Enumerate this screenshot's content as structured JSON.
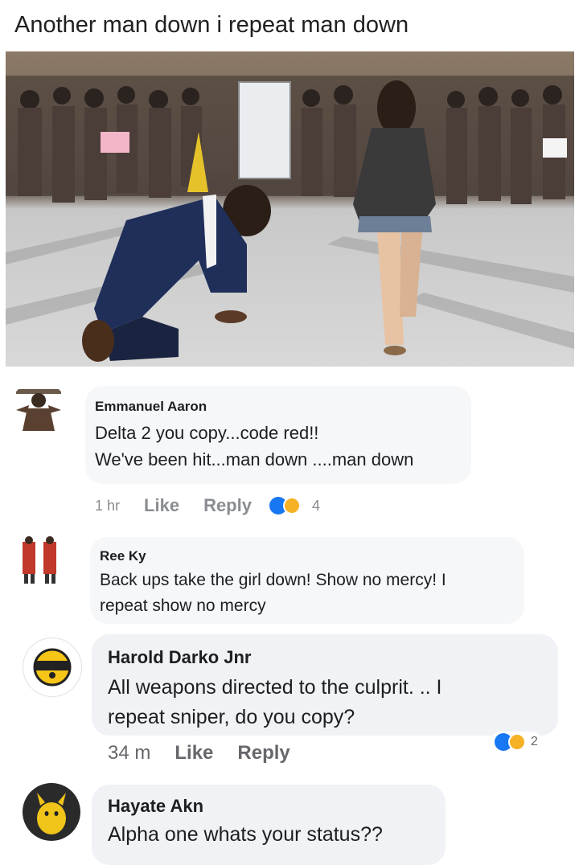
{
  "post": {
    "title": "Another man down i repeat man down"
  },
  "photo": {
    "description_icon": "image",
    "accent_suit": "#1f2f5a",
    "floor_color": "#c9c9c9"
  },
  "comments": [
    {
      "name": "Emmanuel Aaron",
      "text": "Delta 2 you copy...code red!!\nWe've been hit...man down ....man down",
      "time": "1 hr",
      "like": "Like",
      "reply": "Reply",
      "reactions": "4",
      "reaction_icons": [
        "like-icon",
        "haha-icon"
      ]
    },
    {
      "name": "Ree Ky",
      "text": "Back ups take the girl down! Show no mercy! I\nrepeat show no mercy"
    },
    {
      "name": "Harold Darko Jnr",
      "text": "All weapons directed to the culprit. .. I\nrepeat sniper, do you copy?",
      "time": "34 m",
      "like": "Like",
      "reply": "Reply",
      "reactions": "2",
      "reaction_icons": [
        "like-icon",
        "haha-icon"
      ]
    },
    {
      "name": "Hayate Akn",
      "text": "Alpha one whats your status??"
    }
  ],
  "colors": {
    "bubble": "#f0f2f5",
    "meta_text": "#65676b",
    "like_blue": "#1877f2",
    "haha_yellow": "#f7b125"
  }
}
